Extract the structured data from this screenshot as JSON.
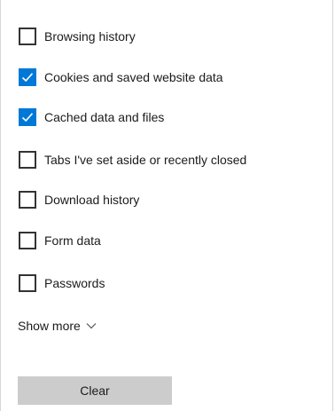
{
  "clear_browsing_data": {
    "items": [
      {
        "label": "Browsing history",
        "checked": false
      },
      {
        "label": "Cookies and saved website data",
        "checked": true
      },
      {
        "label": "Cached data and files",
        "checked": true
      },
      {
        "label": "Tabs I've set aside or recently closed",
        "checked": false
      },
      {
        "label": "Download history",
        "checked": false
      },
      {
        "label": "Form data",
        "checked": false
      },
      {
        "label": "Passwords",
        "checked": false
      }
    ],
    "show_more_label": "Show more",
    "show_more_icon": "chevron-down-icon",
    "clear_button_label": "Clear",
    "colors": {
      "checkbox_checked": "#0078d7",
      "checkbox_border": "#333333",
      "button_background": "#cccccc",
      "text": "#1b1b1b"
    }
  }
}
